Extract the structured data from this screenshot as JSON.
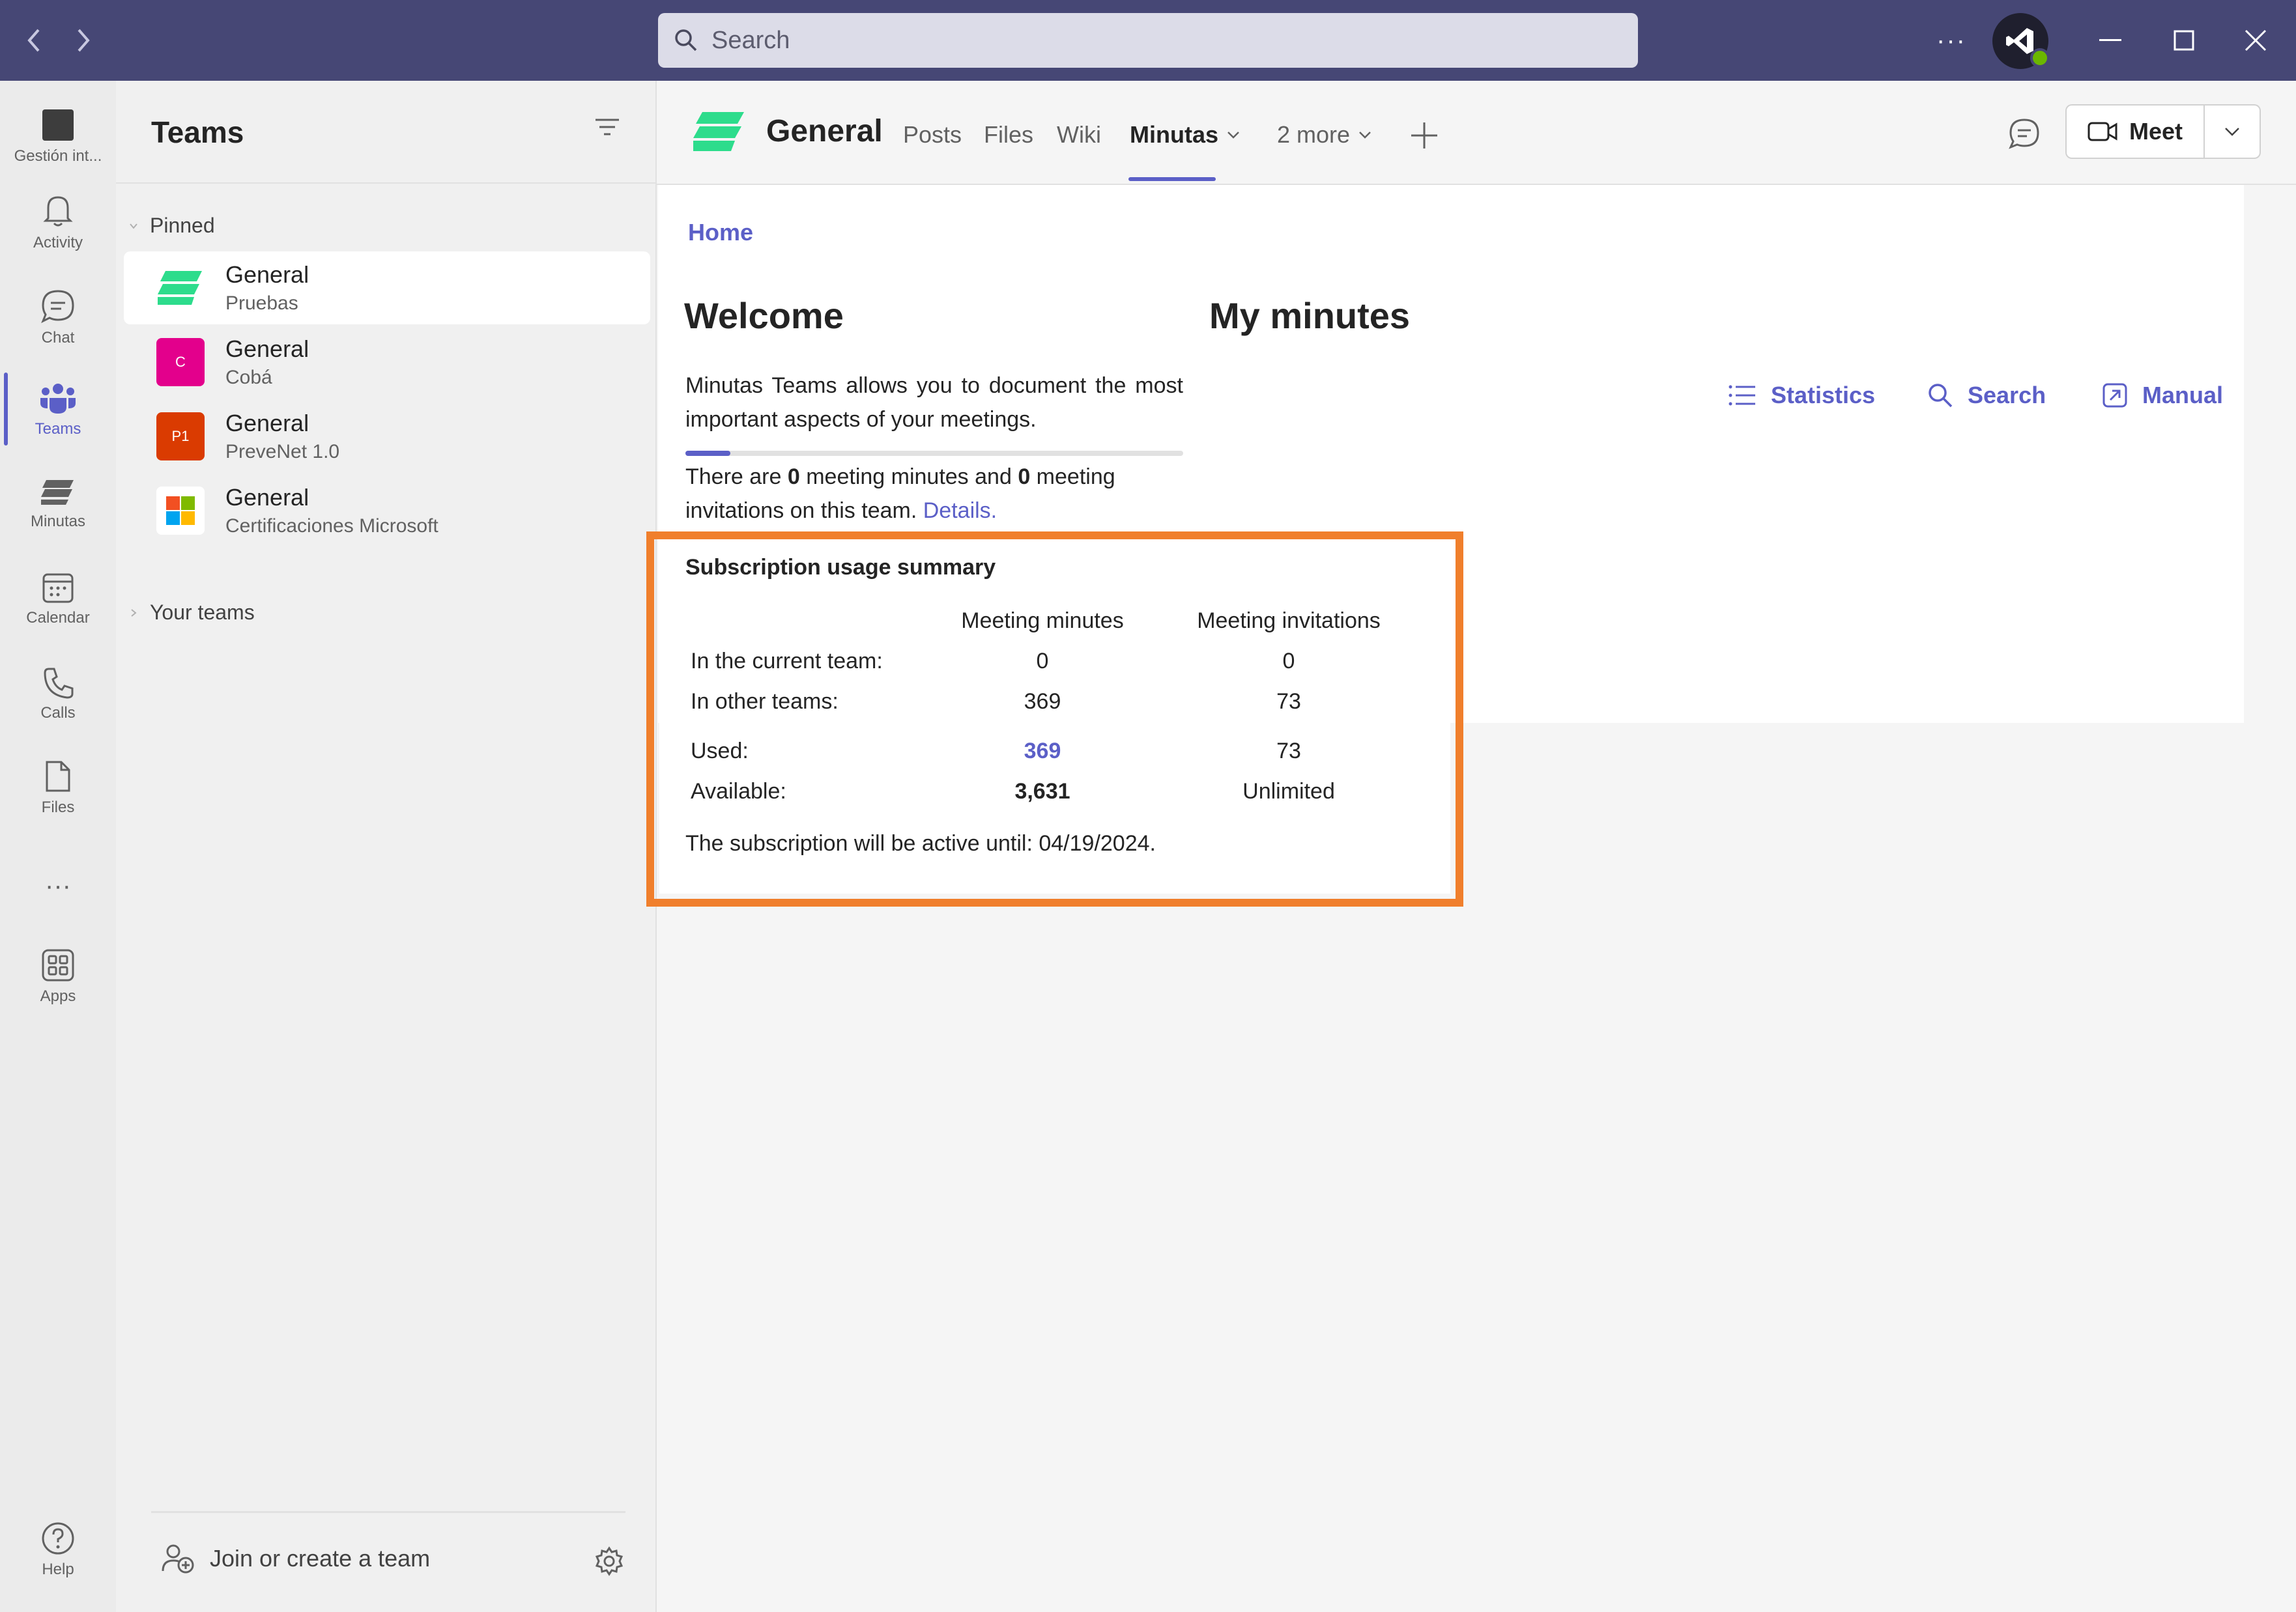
{
  "titlebar": {
    "search_placeholder": "Search",
    "more_label": "···",
    "colors": {
      "bar": "#464775",
      "accent": "#5b5fc7"
    }
  },
  "rail": {
    "items": [
      {
        "label": "Gestión int...",
        "icon": "app-tile-icon"
      },
      {
        "label": "Activity",
        "icon": "bell-icon"
      },
      {
        "label": "Chat",
        "icon": "chat-icon"
      },
      {
        "label": "Teams",
        "icon": "teams-icon",
        "active": true
      },
      {
        "label": "Minutas",
        "icon": "minutas-icon"
      },
      {
        "label": "Calendar",
        "icon": "calendar-icon"
      },
      {
        "label": "Calls",
        "icon": "phone-icon"
      },
      {
        "label": "Files",
        "icon": "file-icon"
      },
      {
        "label": "···",
        "icon": "more-icon"
      },
      {
        "label": "Apps",
        "icon": "apps-icon"
      },
      {
        "label": "Help",
        "icon": "help-icon"
      }
    ]
  },
  "teams_panel": {
    "title": "Teams",
    "pinned_label": "Pinned",
    "your_teams_label": "Your teams",
    "teams": [
      {
        "name": "General",
        "team": "Pruebas",
        "logo": "minutas-logo",
        "selected": true
      },
      {
        "name": "General",
        "team": "Cobá",
        "logo_text": "C",
        "color": "#e3008c"
      },
      {
        "name": "General",
        "team": "PreveNet 1.0",
        "logo_text": "P1",
        "color": "#da3b01"
      },
      {
        "name": "General",
        "team": "Certificaciones Microsoft",
        "logo": "microsoft-logo"
      }
    ],
    "join_label": "Join or create a team"
  },
  "channel": {
    "name": "General",
    "tabs": [
      "Posts",
      "Files",
      "Wiki",
      "Minutas"
    ],
    "active_tab": "Minutas",
    "more_tabs": "2 more",
    "meet_label": "Meet"
  },
  "content": {
    "breadcrumb": "Home",
    "welcome_title": "Welcome",
    "welcome_desc": "Minutas Teams allows you to document the most important aspects of your meetings.",
    "progress_fraction": 0.09,
    "count_prefix": "There are ",
    "minutes_count": "0",
    "count_middle": " meeting minutes and ",
    "invitations_count": "0",
    "count_suffix": " meeting invitations on this team. ",
    "details_link": "Details.",
    "my_minutes_title": "My minutes",
    "actions": [
      {
        "label": "Statistics",
        "icon": "list-icon"
      },
      {
        "label": "Search",
        "icon": "search-icon"
      },
      {
        "label": "Manual",
        "icon": "external-link-icon"
      }
    ]
  },
  "subscription": {
    "title": "Subscription usage summary",
    "col_minutes": "Meeting minutes",
    "col_invitations": "Meeting invitations",
    "rows": [
      {
        "label": "In the current team:",
        "minutes": "0",
        "invitations": "0"
      },
      {
        "label": "In other teams:",
        "minutes": "369",
        "invitations": "73"
      },
      {
        "label": "Used:",
        "minutes": "369",
        "invitations": "73"
      },
      {
        "label": "Available:",
        "minutes": "3,631",
        "invitations": "Unlimited"
      }
    ],
    "footer": "The subscription will be active until: 04/19/2024.",
    "highlight_color": "#f07f2c"
  }
}
